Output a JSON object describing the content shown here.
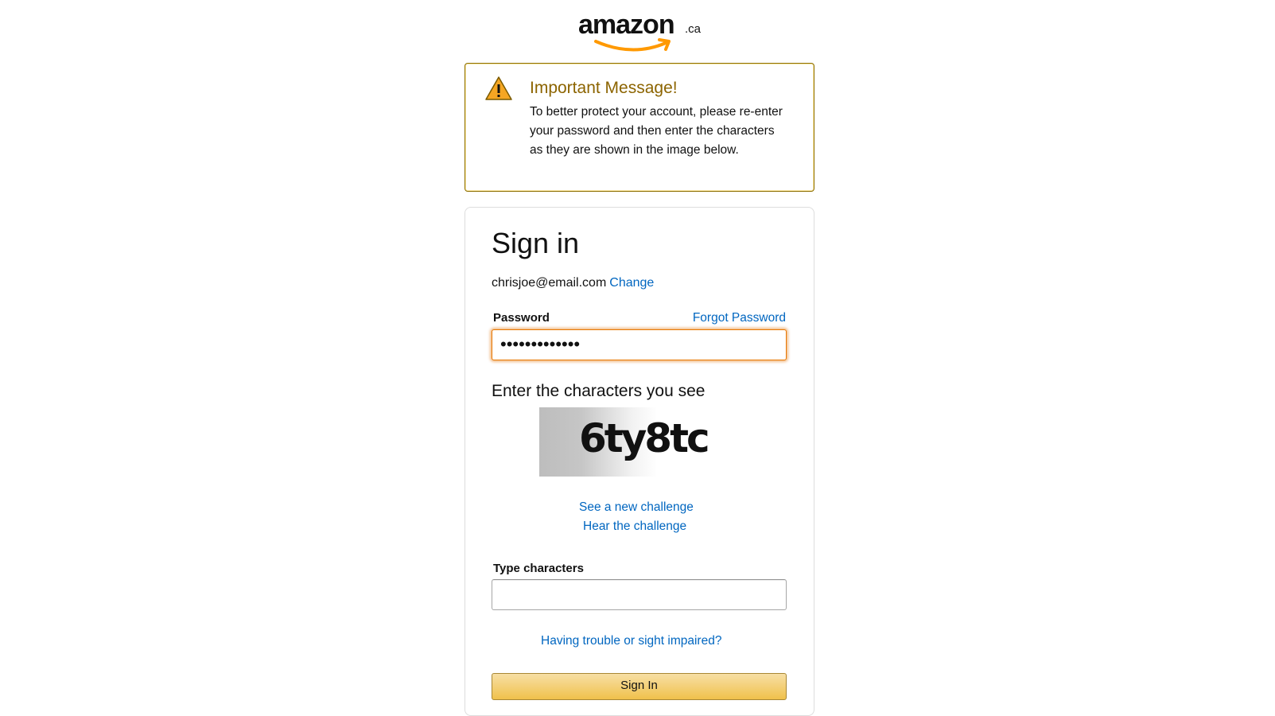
{
  "brand": {
    "name": "amazon",
    "tld": ".ca",
    "accent_color": "#ff9900"
  },
  "alert": {
    "icon": "warning-triangle-icon",
    "title": "Important Message!",
    "body": "To better protect your account, please re-enter your password and then enter the characters as they are shown in the image below."
  },
  "signin": {
    "heading": "Sign in",
    "email": "chrisjoe@email.com",
    "change_link": "Change",
    "password_label": "Password",
    "forgot_link": "Forgot Password",
    "password_value": "•••••••••••••",
    "captcha_heading": "Enter the characters you see",
    "captcha_text": "6ty8tc",
    "new_challenge_link": "See a new challenge",
    "hear_challenge_link": "Hear the challenge",
    "type_label": "Type characters",
    "type_value": "",
    "trouble_link": "Having trouble or sight impaired?",
    "submit_label": "Sign In"
  }
}
